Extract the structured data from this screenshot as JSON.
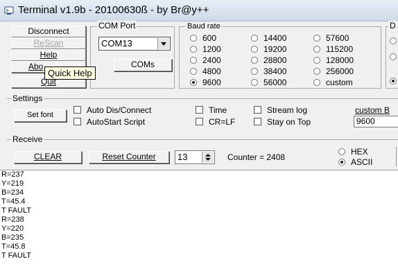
{
  "window": {
    "title": "Terminal v1.9b - 20100630ß - by Br@y++"
  },
  "connection_buttons": {
    "disconnect": "Disconnect",
    "rescan": "ReScan",
    "help": "Help",
    "about": "Abo",
    "quit": "Quit"
  },
  "tooltip": {
    "text": "Quick Help"
  },
  "com_port": {
    "legend": "COM Port",
    "selected": "COM13",
    "coms_button": "COMs"
  },
  "baud_rate": {
    "legend": "Baud rate",
    "options": [
      "600",
      "14400",
      "57600",
      "1200",
      "19200",
      "115200",
      "2400",
      "28800",
      "128000",
      "4800",
      "38400",
      "256000",
      "9600",
      "56000",
      "custom"
    ],
    "selected": "9600"
  },
  "partial_group_right": {
    "legend": "D"
  },
  "settings": {
    "legend": "Settings",
    "set_font": "Set font",
    "auto_dis_connect": "Auto Dis/Connect",
    "autostart_script": "AutoStart Script",
    "time": "Time",
    "cr_lf": "CR=LF",
    "stream_log": "Stream log",
    "stay_on_top": "Stay on Top",
    "custom_br_label": "custom B",
    "custom_br_value": "9600"
  },
  "receive": {
    "legend": "Receive",
    "clear": "CLEAR",
    "reset_counter": "Reset Counter",
    "counter_interval": "13",
    "counter_label": "Counter = 2408",
    "hex": "HEX",
    "ascii": "ASCII",
    "selected_mode": "ASCII"
  },
  "received_lines": [
    "R=237",
    "Y=219",
    "B=234",
    "T=45.4",
    "T FAULT",
    "R=238",
    "Y=220",
    "B=235",
    "T=45.8",
    "T FAULT"
  ]
}
